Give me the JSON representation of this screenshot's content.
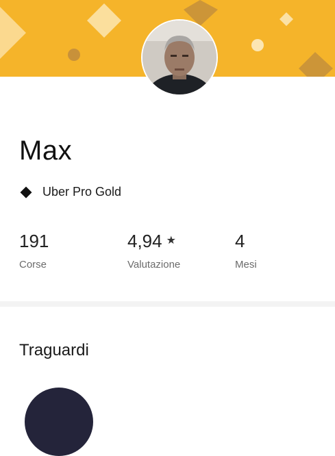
{
  "profile": {
    "name": "Max",
    "tier_label": "Uber Pro Gold"
  },
  "stats": [
    {
      "value": "191",
      "label": "Corse"
    },
    {
      "value": "4,94",
      "label": "Valutazione",
      "icon": "star-icon"
    },
    {
      "value": "4",
      "label": "Mesi"
    }
  ],
  "sections": {
    "milestones_title": "Traguardi"
  },
  "colors": {
    "banner": "#f5b42a",
    "banner_shape_light": "#fce6b2",
    "banner_shape_dark": "#c8913a",
    "milestone_circle": "#24243a"
  }
}
